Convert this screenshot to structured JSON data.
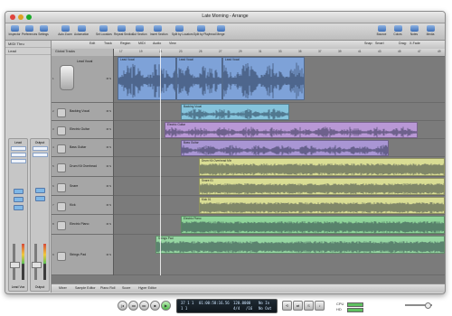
{
  "window": {
    "title": "Late Morning - Arrange"
  },
  "toolbar": [
    {
      "label": "Inspector"
    },
    {
      "label": "Preferences"
    },
    {
      "label": "Settings"
    },
    {
      "label": "Auto Zoom"
    },
    {
      "label": "Automation"
    },
    {
      "label": "Set Locators"
    },
    {
      "label": "Repeat Section"
    },
    {
      "label": "Cut Section"
    },
    {
      "label": "Insert Section"
    },
    {
      "label": "Split by Locators"
    },
    {
      "label": "Split by Playhead"
    },
    {
      "label": "Merge"
    },
    {
      "label": "Bounce"
    },
    {
      "label": "Colors"
    },
    {
      "label": "Notes"
    },
    {
      "label": "Media"
    }
  ],
  "inspector": {
    "region_header": "MIDI Thru",
    "track_header": "Lead",
    "strip_left": {
      "name": "Lead",
      "value": "0.0",
      "label": "Lead Vox"
    },
    "strip_right": {
      "name": "Output",
      "value": "0.0",
      "label": "Output"
    }
  },
  "arrange_menu": [
    "Edit",
    "Track",
    "Region",
    "MIDI",
    "Audio",
    "View"
  ],
  "snap": {
    "label": "Snap:",
    "value": "Smart"
  },
  "drag": {
    "label": "Drag:",
    "value": "X-Fade"
  },
  "tracklist_header": "Global Tracks",
  "ruler_ticks": [
    "17",
    "19",
    "21",
    "23",
    "25",
    "27",
    "29",
    "31",
    "33",
    "35",
    "37",
    "39",
    "41",
    "43",
    "45",
    "47",
    "49"
  ],
  "tracks": [
    {
      "num": "1",
      "name": "Lead Vocal",
      "ms": "M S",
      "icon": "microphone-icon"
    },
    {
      "num": "2",
      "name": "Backing Vocal",
      "ms": "M S",
      "icon": "microphone-icon"
    },
    {
      "num": "3",
      "name": "Electric Guitar",
      "ms": "M S",
      "icon": "guitar-icon"
    },
    {
      "num": "4",
      "name": "Bass Guitar",
      "ms": "M S",
      "icon": "bass-icon"
    },
    {
      "num": "5",
      "name": "Drum Kit Overhead",
      "ms": "M S",
      "icon": "drum-icon"
    },
    {
      "num": "6",
      "name": "Snare",
      "ms": "M S",
      "icon": "snare-icon"
    },
    {
      "num": "7",
      "name": "Kick",
      "ms": "M S",
      "icon": "kick-drum-icon"
    },
    {
      "num": "8",
      "name": "Electric Piano",
      "ms": "M S",
      "icon": "keyboard-icon"
    },
    {
      "num": "9",
      "name": "Strings Pad",
      "ms": "M S",
      "icon": "keyboard-icon"
    }
  ],
  "regions": [
    {
      "name": "Lead Vocal",
      "color": "#7ea2d8"
    },
    {
      "name": "Lead Vocal",
      "color": "#7ea2d8"
    },
    {
      "name": "Lead Vocal",
      "color": "#7ea2d8"
    },
    {
      "name": "Backing Vocal",
      "color": "#85c4dc"
    },
    {
      "name": "Electric Guitar",
      "color": "#b998d6"
    },
    {
      "name": "Bass Guitar",
      "color": "#a996d4"
    },
    {
      "name": "Drum Kit Overhead Mix",
      "color": "#d9dd94"
    },
    {
      "name": "Snare 01",
      "color": "#d9dd94"
    },
    {
      "name": "Kick 01",
      "color": "#d9dd94"
    },
    {
      "name": "Electric Piano",
      "color": "#8fd49a"
    },
    {
      "name": "Strings Pad",
      "color": "#96d6a2"
    }
  ],
  "bottom_tabs": [
    "Mixer",
    "Sample Editor",
    "Piano Roll",
    "Score",
    "Hyper Editor"
  ],
  "transport": {
    "lcd_bars": "37 1 1",
    "lcd_sub": "1 1",
    "lcd_time": "01:00:58:16.56",
    "tempo": "120.0000",
    "signature": "4/4",
    "division": "/16",
    "in": "No In",
    "out": "No Out",
    "cpu_label": "CPU",
    "hd_label": "HD"
  }
}
